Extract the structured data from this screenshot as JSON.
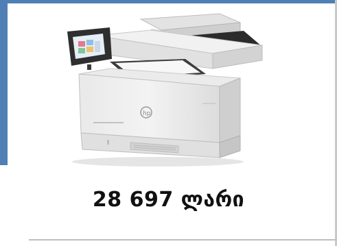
{
  "product": {
    "image_icon": "printer-icon",
    "price_text": "28 697 ლარი"
  },
  "colors": {
    "accent": "#4f7fb5",
    "price": "#111111"
  }
}
